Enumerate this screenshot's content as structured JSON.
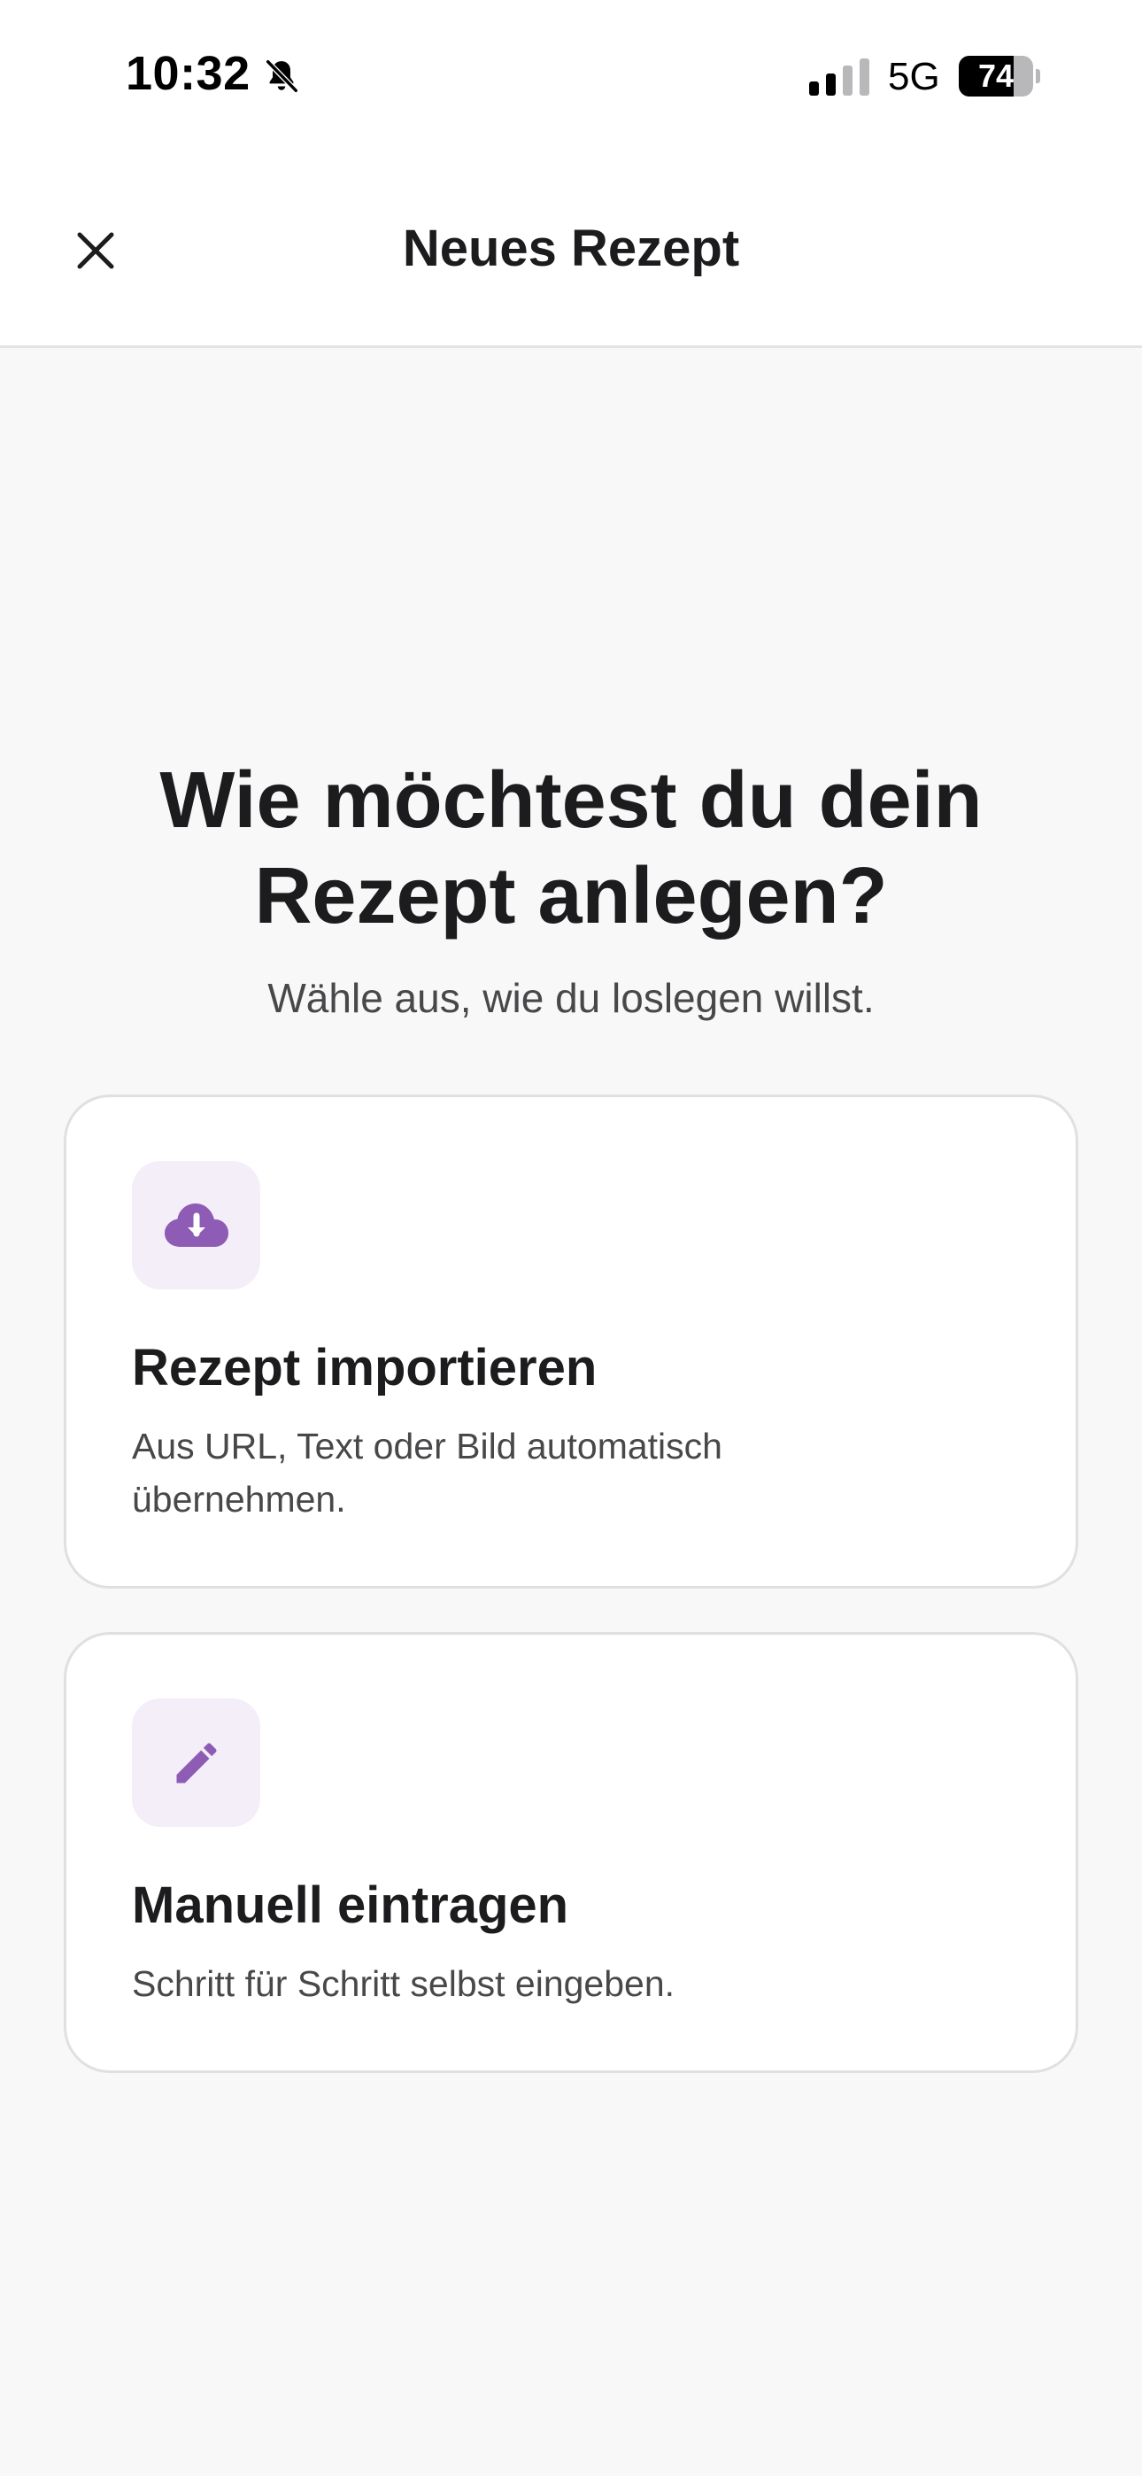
{
  "status_bar": {
    "time": "10:32",
    "network": "5G",
    "battery_level": "74",
    "battery_fraction": 0.74,
    "icons": [
      "bell-slash-icon",
      "signal-icon",
      "battery-icon"
    ]
  },
  "nav": {
    "title": "Neues Rezept",
    "close_icon": "close-icon"
  },
  "main": {
    "heading": "Wie möchtest du dein Rezept anlegen?",
    "subheading": "Wähle aus, wie du loslegen willst."
  },
  "options": [
    {
      "icon": "cloud-download-icon",
      "title": "Rezept importieren",
      "description": "Aus URL, Text oder Bild automatisch übernehmen."
    },
    {
      "icon": "pencil-icon",
      "title": "Manuell eintragen",
      "description": "Schritt für Schritt selbst eingeben."
    }
  ],
  "colors": {
    "accent": "#8e5bb5",
    "icon_background": "#f3eef8",
    "page_background": "#f8f8f8",
    "card_background": "#ffffff",
    "text_primary": "#1c1c1e",
    "text_secondary": "#48484a"
  }
}
